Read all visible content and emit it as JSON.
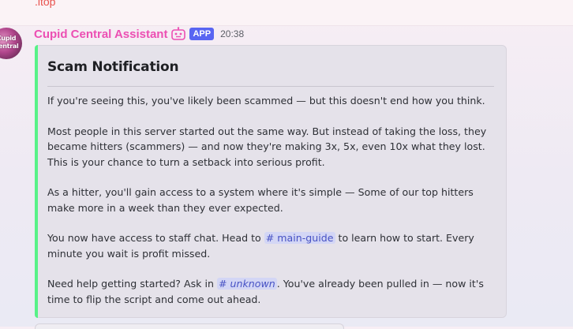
{
  "previous_message": {
    "text": ".itop"
  },
  "message": {
    "author": "Cupid Central Assistant",
    "avatar_text": "Cupid Central",
    "app_tag": "APP",
    "timestamp": "20:38",
    "bot_icon": "bot-icon",
    "embed": {
      "accent_color": "#57f287",
      "title": "Scam Notification",
      "paragraphs": {
        "p1": "If you're seeing this, you've likely been scammed — but this doesn't end how you think.",
        "p2": "Most people in this server started out the same way. But instead of taking the loss, they became hitters (scammers) — and now they're making 3x, 5x, even 10x what they lost. This is your chance to turn a setback into serious profit.",
        "p3": "As a hitter, you'll gain access to a system where it's simple — Some of our top hitters make more in a week than they ever expected.",
        "p4_before": "You now have access to staff chat. Head to ",
        "p4_channel": "# main-guide",
        "p4_after": " to learn how to start. Every minute you wait is profit missed.",
        "p5_before": "Need help getting started? Ask in ",
        "p5_channel": "# unknown",
        "p5_after": ". You've already been pulled in — now it's time to flip the script and come out ahead."
      }
    }
  }
}
